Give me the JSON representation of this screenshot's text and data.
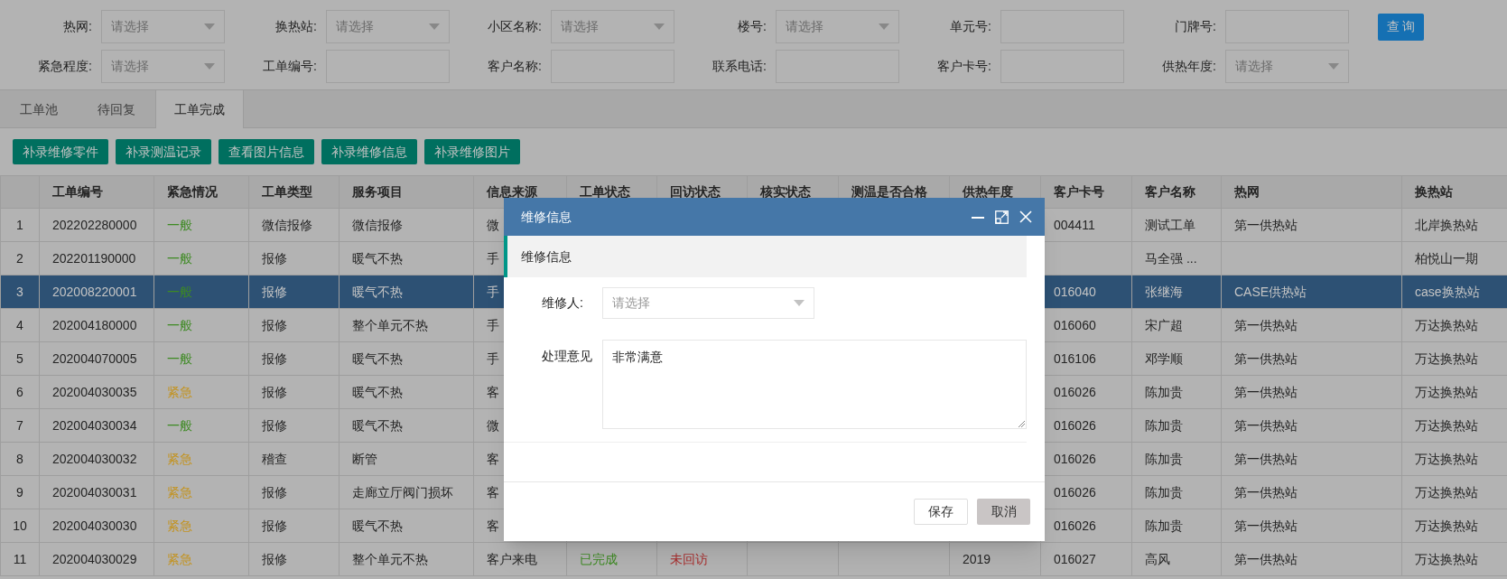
{
  "filters": [
    {
      "label": "热网:",
      "kind": "select",
      "placeholder": "请选择"
    },
    {
      "label": "换热站:",
      "kind": "select",
      "placeholder": "请选择"
    },
    {
      "label": "小区名称:",
      "kind": "select",
      "placeholder": "请选择"
    },
    {
      "label": "楼号:",
      "kind": "select",
      "placeholder": "请选择"
    },
    {
      "label": "单元号:",
      "kind": "input"
    },
    {
      "label": "门牌号:",
      "kind": "input"
    },
    {
      "label": "紧急程度:",
      "kind": "select",
      "placeholder": "请选择"
    },
    {
      "label": "工单编号:",
      "kind": "input"
    },
    {
      "label": "客户名称:",
      "kind": "input"
    },
    {
      "label": "联系电话:",
      "kind": "input"
    },
    {
      "label": "客户卡号:",
      "kind": "input"
    },
    {
      "label": "供热年度:",
      "kind": "select",
      "placeholder": "请选择"
    }
  ],
  "query_button": "查 询",
  "tabs": [
    {
      "label": "工单池",
      "selected": false
    },
    {
      "label": "待回复",
      "selected": false
    },
    {
      "label": "工单完成",
      "selected": true
    }
  ],
  "toolbar_buttons": [
    "补录维修零件",
    "补录测温记录",
    "查看图片信息",
    "补录维修信息",
    "补录维修图片"
  ],
  "table": {
    "columns": [
      "工单编号",
      "紧急情况",
      "工单类型",
      "服务项目",
      "信息来源",
      "工单状态",
      "回访状态",
      "核实状态",
      "测温是否合格",
      "供热年度",
      "客户卡号",
      "客户名称",
      "热网",
      "换热站"
    ],
    "rows": [
      {
        "number": "1",
        "selected": false,
        "cells": [
          "202202280000",
          {
            "text": "一般",
            "color": "#3d8a22"
          },
          "微信报修",
          "微信报修",
          "微",
          null,
          null,
          null,
          null,
          null,
          "004411",
          "测试工单",
          "第一供热站",
          "北岸换热站"
        ]
      },
      {
        "number": "2",
        "selected": false,
        "cells": [
          "202201190000",
          {
            "text": "一般",
            "color": "#3d8a22"
          },
          "报修",
          "暖气不热",
          "手",
          null,
          null,
          null,
          null,
          null,
          null,
          "马全强 ...",
          null,
          "柏悦山一期"
        ]
      },
      {
        "number": "3",
        "selected": true,
        "cells": [
          "202008220001",
          {
            "text": "一般",
            "color": "#3d8a22"
          },
          "报修",
          "暖气不热",
          "手",
          null,
          null,
          null,
          null,
          null,
          "016040",
          "张继海",
          "CASE供热站",
          "case换热站"
        ]
      },
      {
        "number": "4",
        "selected": false,
        "cells": [
          "202004180000",
          {
            "text": "一般",
            "color": "#3d8a22"
          },
          "报修",
          "整个单元不热",
          "手",
          null,
          null,
          null,
          null,
          null,
          "016060",
          "宋广超",
          "第一供热站",
          "万达换热站"
        ]
      },
      {
        "number": "5",
        "selected": false,
        "cells": [
          "202004070005",
          {
            "text": "一般",
            "color": "#3d8a22"
          },
          "报修",
          "暖气不热",
          "手",
          null,
          null,
          null,
          null,
          null,
          "016106",
          "邓学顺",
          "第一供热站",
          "万达换热站"
        ]
      },
      {
        "number": "6",
        "selected": false,
        "cells": [
          "202004030035",
          {
            "text": "紧急",
            "color": "#c39320"
          },
          "报修",
          "暖气不热",
          "客",
          null,
          null,
          null,
          null,
          null,
          "016026",
          "陈加贵",
          "第一供热站",
          "万达换热站"
        ]
      },
      {
        "number": "7",
        "selected": false,
        "cells": [
          "202004030034",
          {
            "text": "一般",
            "color": "#3d8a22"
          },
          "报修",
          "暖气不热",
          "微",
          null,
          null,
          null,
          null,
          null,
          "016026",
          "陈加贵",
          "第一供热站",
          "万达换热站"
        ]
      },
      {
        "number": "8",
        "selected": false,
        "cells": [
          "202004030032",
          {
            "text": "紧急",
            "color": "#c39320"
          },
          "稽查",
          "断管",
          "客",
          null,
          null,
          null,
          null,
          null,
          "016026",
          "陈加贵",
          "第一供热站",
          "万达换热站"
        ]
      },
      {
        "number": "9",
        "selected": false,
        "cells": [
          "202004030031",
          {
            "text": "紧急",
            "color": "#c39320"
          },
          "报修",
          "走廊立厅阀门损坏",
          "客",
          null,
          null,
          null,
          null,
          null,
          "016026",
          "陈加贵",
          "第一供热站",
          "万达换热站"
        ]
      },
      {
        "number": "10",
        "selected": false,
        "cells": [
          "202004030030",
          {
            "text": "紧急",
            "color": "#c39320"
          },
          "报修",
          "暖气不热",
          "客",
          null,
          null,
          null,
          null,
          null,
          "016026",
          "陈加贵",
          "第一供热站",
          "万达换热站"
        ]
      },
      {
        "number": "11",
        "selected": false,
        "cells": [
          "202004030029",
          {
            "text": "紧急",
            "color": "#c39320"
          },
          "报修",
          "整个单元不热",
          "客户来电",
          {
            "text": "已完成",
            "color": "#3d8a22"
          },
          {
            "text": "未回访",
            "color": "#a82b2b"
          },
          null,
          null,
          "2019",
          "016027",
          "高风",
          "第一供热站",
          "万达换热站"
        ]
      }
    ]
  },
  "dialog": {
    "title": "维修信息",
    "section": "维修信息",
    "fields": [
      {
        "label": "维修人:",
        "kind": "select",
        "placeholder": "请选择"
      },
      {
        "label": "处理意见",
        "kind": "textarea",
        "value": "非常满意"
      }
    ],
    "buttons": [
      {
        "label": "保存",
        "kind": "secondary"
      },
      {
        "label": "取消",
        "kind": "cancel"
      }
    ]
  }
}
